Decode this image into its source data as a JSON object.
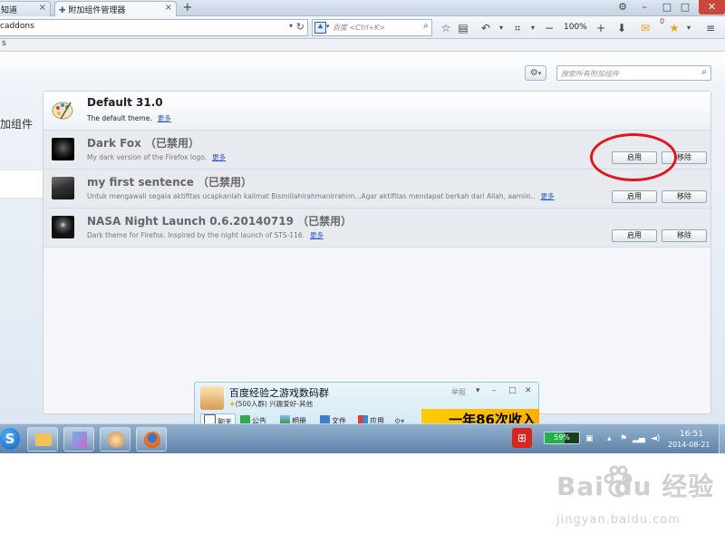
{
  "browser": {
    "tabs": [
      {
        "label": "知道",
        "active": false
      },
      {
        "label": "附加组件管理器",
        "active": true
      }
    ],
    "url": "caddons",
    "search_placeholder": "百度 <Ctrl+K>",
    "zoom": "100%",
    "notification_count": "0",
    "bookmarks_text": "s"
  },
  "addons_page": {
    "category_label": "加组件",
    "search_placeholder": "搜索所有附加组件",
    "gear_icon": "gear-icon",
    "items": [
      {
        "name": "Default  31.0",
        "desc": "The default theme.",
        "more": "更多",
        "status": "active",
        "theme_color": "#3b7bd8"
      },
      {
        "name": "Dark Fox  （已禁用）",
        "desc": "My dark version of the Firefox logo.",
        "more": "更多",
        "status": "disabled",
        "theme_color": "#111111",
        "enable": "启用",
        "remove": "移除"
      },
      {
        "name": "my first sentence  （已禁用）",
        "desc": "Untuk mengawali segala aktifitas ucapkanlah kalimat Bismillahirahmanirrahim...Agar aktifitas mendapat berkah dari Allah, aamiin..",
        "more": "更多",
        "status": "disabled",
        "theme_color": "#2a2a2a",
        "enable": "启用",
        "remove": "移除"
      },
      {
        "name": "NASA Night Launch  0.6.20140719  （已禁用）",
        "desc": "Dark theme for Firefox.  Inspired by the night launch of STS-116.",
        "more": "更多",
        "status": "disabled",
        "theme_color": "#1a1a1a",
        "enable": "启用",
        "remove": "移除"
      }
    ]
  },
  "qq_popup": {
    "title": "百度经验之游戏数码群",
    "subtitle": "(500人群) 兴趣爱好-其他",
    "report": "举报",
    "tabs": [
      "聊天",
      "公告",
      "相册",
      "文件",
      "应用"
    ],
    "ad_text": "一年86次收入"
  },
  "taskbar": {
    "battery": "59%",
    "battery_level": 0.59,
    "time": "16:51",
    "date": "2014-08-21"
  },
  "watermark": {
    "logo": "Bai du 经验",
    "url": "jingyan.baidu.com"
  },
  "colors": {
    "link": "#2a57c9",
    "annotation": "#e2151d",
    "close_button": "#c9463d"
  }
}
